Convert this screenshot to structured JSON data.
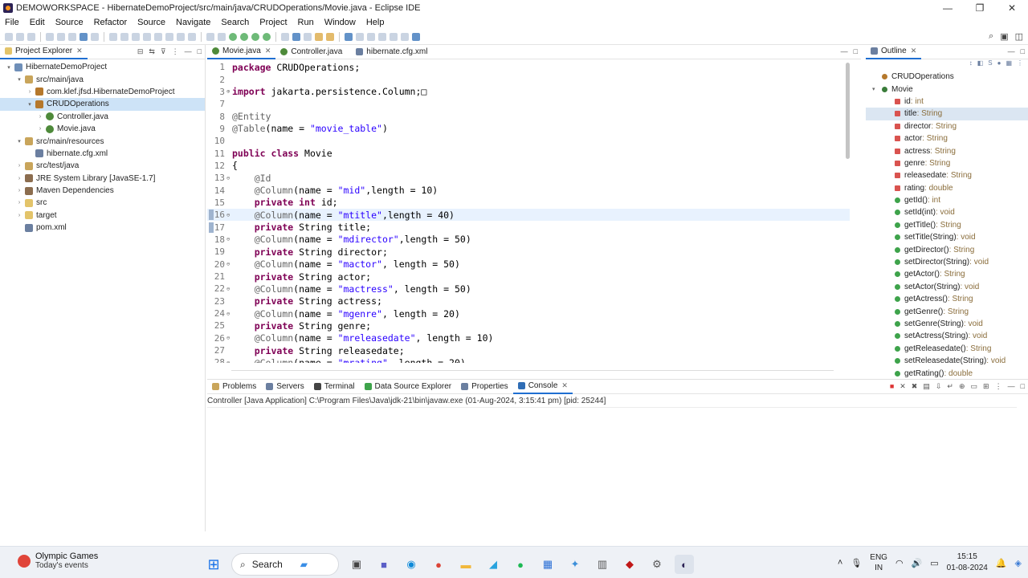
{
  "window": {
    "title": "DEMOWORKSPACE - HibernateDemoProject/src/main/java/CRUDOperations/Movie.java - Eclipse IDE",
    "minimize": "—",
    "maximize": "❐",
    "close": "✕"
  },
  "menu": [
    "File",
    "Edit",
    "Source",
    "Refactor",
    "Source",
    "Navigate",
    "Search",
    "Project",
    "Run",
    "Window",
    "Help"
  ],
  "explorer": {
    "tab_label": "Project Explorer",
    "items": [
      {
        "label": "HibernateDemoProject",
        "level": 0,
        "toggle": "▾",
        "icon": "project-icon"
      },
      {
        "label": "src/main/java",
        "level": 1,
        "toggle": "▾",
        "icon": "source-folder-icon"
      },
      {
        "label": "com.klef.jfsd.HibernateDemoProject",
        "level": 2,
        "toggle": "›",
        "icon": "package-icon"
      },
      {
        "label": "CRUDOperations",
        "level": 2,
        "toggle": "▾",
        "icon": "package-icon"
      },
      {
        "label": "Controller.java",
        "level": 3,
        "toggle": "›",
        "icon": "java-file-icon"
      },
      {
        "label": "Movie.java",
        "level": 3,
        "toggle": "›",
        "icon": "java-file-icon"
      },
      {
        "label": "src/main/resources",
        "level": 1,
        "toggle": "▾",
        "icon": "source-folder-icon"
      },
      {
        "label": "hibernate.cfg.xml",
        "level": 2,
        "toggle": "",
        "icon": "xml-file-icon"
      },
      {
        "label": "src/test/java",
        "level": 1,
        "toggle": "›",
        "icon": "source-folder-icon"
      },
      {
        "label": "JRE System Library [JavaSE-1.7]",
        "level": 1,
        "toggle": "›",
        "icon": "library-icon"
      },
      {
        "label": "Maven Dependencies",
        "level": 1,
        "toggle": "›",
        "icon": "library-icon"
      },
      {
        "label": "src",
        "level": 1,
        "toggle": "›",
        "icon": "folder-icon"
      },
      {
        "label": "target",
        "level": 1,
        "toggle": "›",
        "icon": "folder-icon"
      },
      {
        "label": "pom.xml",
        "level": 1,
        "toggle": "",
        "icon": "xml-file-icon"
      }
    ]
  },
  "editor": {
    "tabs": [
      {
        "label": "Movie.java",
        "close": "✕"
      },
      {
        "label": "Controller.java",
        "close": ""
      },
      {
        "label": "hibernate.cfg.xml",
        "close": ""
      }
    ],
    "lines": [
      {
        "n": "1",
        "fold": "",
        "text": "package CRUDOperations;"
      },
      {
        "n": "2",
        "fold": "",
        "text": ""
      },
      {
        "n": "3",
        "fold": "⊕",
        "text": "import jakarta.persistence.Column;□"
      },
      {
        "n": "7",
        "fold": "",
        "text": ""
      },
      {
        "n": "8",
        "fold": "",
        "text": "@Entity"
      },
      {
        "n": "9",
        "fold": "",
        "text": "@Table(name = \"movie_table\")"
      },
      {
        "n": "10",
        "fold": "",
        "text": ""
      },
      {
        "n": "11",
        "fold": "",
        "text": "public class Movie"
      },
      {
        "n": "12",
        "fold": "",
        "text": "{"
      },
      {
        "n": "13",
        "fold": "⊖",
        "text": "    @Id"
      },
      {
        "n": "14",
        "fold": "",
        "text": "    @Column(name = \"mid\",length = 10)"
      },
      {
        "n": "15",
        "fold": "",
        "text": "    private int id;"
      },
      {
        "n": "16",
        "fold": "⊖",
        "text": "    @Column(name = \"mtitle\",length = 40)"
      },
      {
        "n": "17",
        "fold": "",
        "text": "    private String title;"
      },
      {
        "n": "18",
        "fold": "⊖",
        "text": "    @Column(name = \"mdirector\",length = 50)"
      },
      {
        "n": "19",
        "fold": "",
        "text": "    private String director;"
      },
      {
        "n": "20",
        "fold": "⊖",
        "text": "    @Column(name = \"mactor\", length = 50)"
      },
      {
        "n": "21",
        "fold": "",
        "text": "    private String actor;"
      },
      {
        "n": "22",
        "fold": "⊖",
        "text": "    @Column(name = \"mactress\", length = 50)"
      },
      {
        "n": "23",
        "fold": "",
        "text": "    private String actress;"
      },
      {
        "n": "24",
        "fold": "⊖",
        "text": "    @Column(name = \"mgenre\", length = 20)"
      },
      {
        "n": "25",
        "fold": "",
        "text": "    private String genre;"
      },
      {
        "n": "26",
        "fold": "⊖",
        "text": "    @Column(name = \"mreleasedate\", length = 10)"
      },
      {
        "n": "27",
        "fold": "",
        "text": "    private String releasedate;"
      },
      {
        "n": "28",
        "fold": "⊖",
        "text": "    @Column(name = \"mrating\", length = 20)"
      }
    ]
  },
  "outline": {
    "tab_label": "Outline",
    "items": [
      {
        "name": "CRUDOperations",
        "type": "",
        "kind": "package"
      },
      {
        "name": "Movie",
        "type": "",
        "kind": "class"
      },
      {
        "name": "id",
        "type": " : int",
        "kind": "field"
      },
      {
        "name": "title",
        "type": " : String",
        "kind": "field"
      },
      {
        "name": "director",
        "type": " : String",
        "kind": "field"
      },
      {
        "name": "actor",
        "type": " : String",
        "kind": "field"
      },
      {
        "name": "actress",
        "type": " : String",
        "kind": "field"
      },
      {
        "name": "genre",
        "type": " : String",
        "kind": "field"
      },
      {
        "name": "releasedate",
        "type": " : String",
        "kind": "field"
      },
      {
        "name": "rating",
        "type": " : double",
        "kind": "field"
      },
      {
        "name": "getId()",
        "type": " : int",
        "kind": "method"
      },
      {
        "name": "setId(int)",
        "type": " : void",
        "kind": "method"
      },
      {
        "name": "getTitle()",
        "type": " : String",
        "kind": "method"
      },
      {
        "name": "setTitle(String)",
        "type": " : void",
        "kind": "method"
      },
      {
        "name": "getDirector()",
        "type": " : String",
        "kind": "method"
      },
      {
        "name": "setDirector(String)",
        "type": " : void",
        "kind": "method"
      },
      {
        "name": "getActor()",
        "type": " : String",
        "kind": "method"
      },
      {
        "name": "setActor(String)",
        "type": " : void",
        "kind": "method"
      },
      {
        "name": "getActress()",
        "type": " : String",
        "kind": "method"
      },
      {
        "name": "getGenre()",
        "type": " : String",
        "kind": "method"
      },
      {
        "name": "setGenre(String)",
        "type": " : void",
        "kind": "method"
      },
      {
        "name": "setActress(String)",
        "type": " : void",
        "kind": "method"
      },
      {
        "name": "getReleasedate()",
        "type": " : String",
        "kind": "method"
      },
      {
        "name": "setReleasedate(String)",
        "type": " : void",
        "kind": "method"
      },
      {
        "name": "getRating()",
        "type": " : double",
        "kind": "method"
      }
    ]
  },
  "bottom": {
    "tabs": [
      "Problems",
      "Servers",
      "Terminal",
      "Data Source Explorer",
      "Properties",
      "Console"
    ],
    "active": "Console",
    "console_header": "Controller [Java Application] C:\\Program Files\\Java\\jdk-21\\bin\\javaw.exe  (01-Aug-2024, 3:15:41 pm) [pid: 25244]"
  },
  "taskbar": {
    "weather_title": "Olympic Games",
    "weather_sub": "Today's events",
    "search_label": "Search",
    "lang_top": "ENG",
    "lang_bottom": "IN",
    "time": "15:15",
    "date": "01-08-2024"
  }
}
